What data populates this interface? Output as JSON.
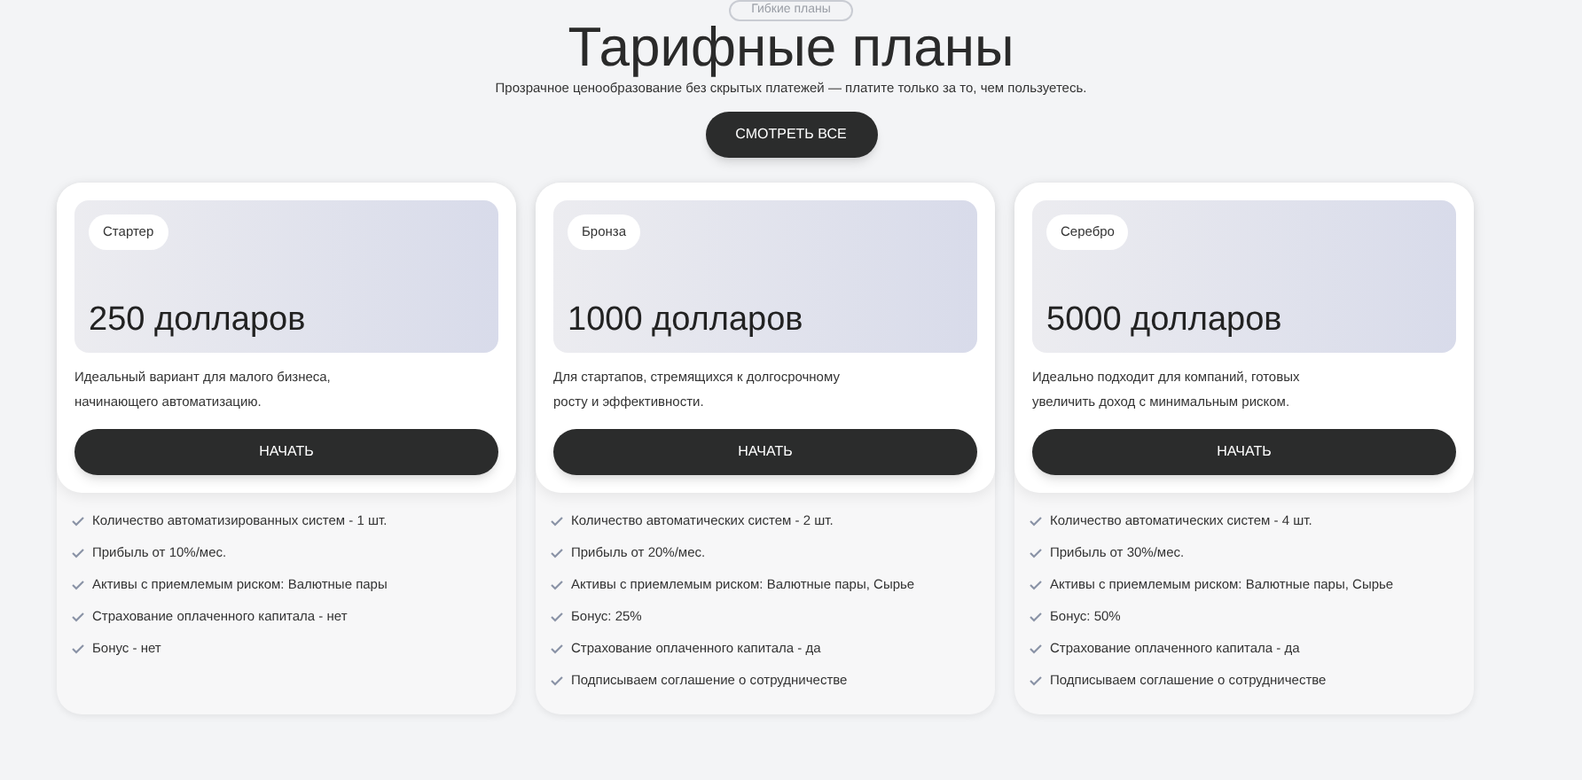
{
  "header": {
    "badge": "Гибкие планы",
    "title": "Тарифные планы",
    "subtitle": "Прозрачное ценообразование без скрытых платежей — платите только за то, чем пользуетесь.",
    "button": "СМОТРЕТЬ ВСЕ"
  },
  "plans": [
    {
      "tag": "Стартер",
      "price": "250 долларов",
      "description": [
        "Идеальный вариант для малого бизнеса,",
        "начинающего автоматизацию."
      ],
      "button": "НАЧАТЬ",
      "features": [
        "Количество автоматизированных систем - 1 шт.",
        "Прибыль от 10%/мес.",
        "Активы с приемлемым риском: Валютные пары",
        "Страхование оплаченного капитала - нет",
        "Бонус - нет"
      ]
    },
    {
      "tag": "Бронза",
      "price": "1000 долларов",
      "description": [
        "Для стартапов, стремящихся к долгосрочному",
        "росту и эффективности."
      ],
      "button": "НАЧАТЬ",
      "features": [
        "Количество автоматических систем - 2 шт.",
        "Прибыль от 20%/мес.",
        "Активы с приемлемым риском: Валютные пары, Сырье",
        "Бонус: 25%",
        "Страхование оплаченного капитала - да",
        "Подписываем соглашение о сотрудничестве"
      ]
    },
    {
      "tag": "Серебро",
      "price": "5000 долларов",
      "description": [
        "Идеально подходит для компаний, готовых",
        "увеличить доход с минимальным риском."
      ],
      "button": "НАЧАТЬ",
      "features": [
        "Количество автоматических систем - 4 шт.",
        "Прибыль от 30%/мес.",
        "Активы с приемлемым риском: Валютные пары, Сырье",
        "Бонус: 50%",
        "Страхование оплаченного капитала - да",
        "Подписываем соглашение о сотрудничестве"
      ]
    }
  ]
}
